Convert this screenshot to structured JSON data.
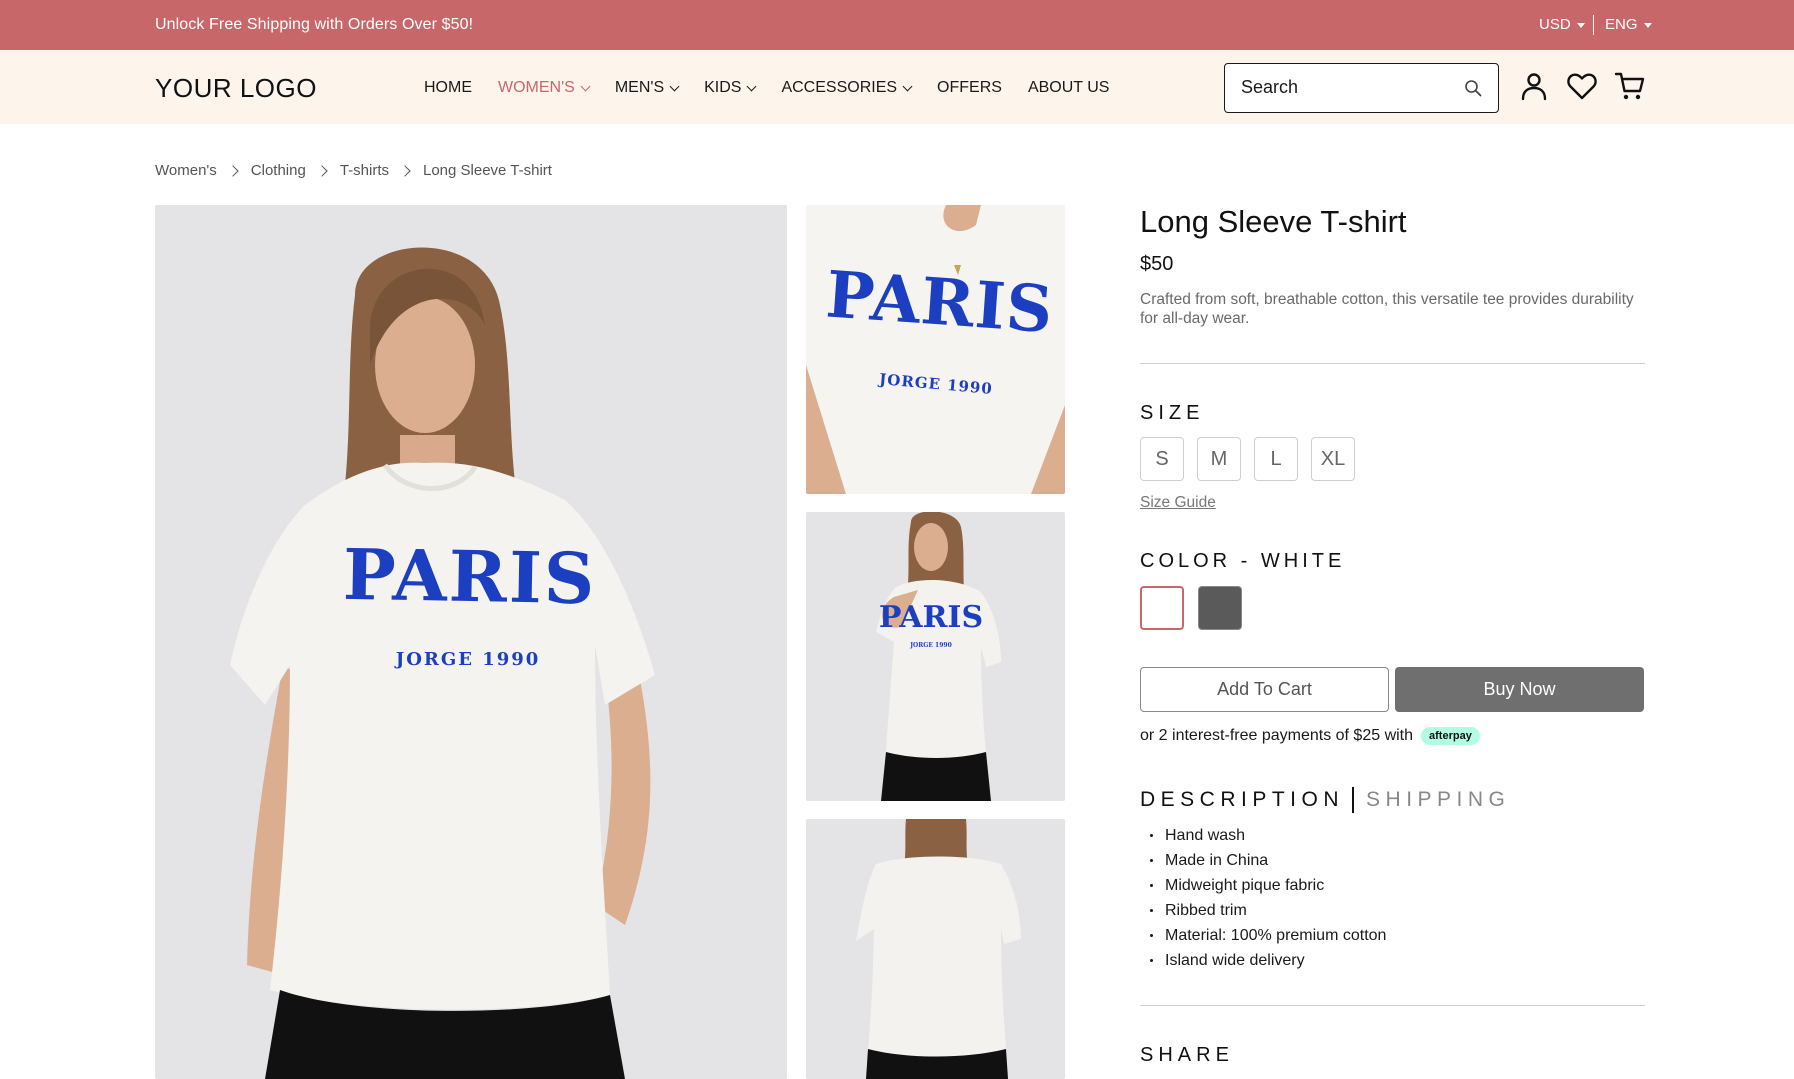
{
  "colors": {
    "brand": "#c8676a",
    "header_bg": "#fdf4ec",
    "buy_now": "#6f6f6f",
    "afterpay": "#b2fce4"
  },
  "promo": {
    "message": "Unlock Free Shipping with Orders Over $50!",
    "currency": "USD",
    "language": "ENG"
  },
  "header": {
    "logo": "YOUR LOGO",
    "nav": [
      {
        "label": "HOME",
        "dropdown": false,
        "active": false
      },
      {
        "label": "WOMEN'S",
        "dropdown": true,
        "active": true
      },
      {
        "label": "MEN'S",
        "dropdown": true,
        "active": false
      },
      {
        "label": "KIDS",
        "dropdown": true,
        "active": false
      },
      {
        "label": "ACCESSORIES",
        "dropdown": true,
        "active": false
      },
      {
        "label": "OFFERS",
        "dropdown": false,
        "active": false
      },
      {
        "label": "ABOUT US",
        "dropdown": false,
        "active": false
      }
    ],
    "search": {
      "placeholder": "Search",
      "icon": "search-icon"
    },
    "icons": [
      "account-icon",
      "wishlist-heart-icon",
      "cart-icon"
    ]
  },
  "breadcrumb": [
    "Women's",
    "Clothing",
    "T-shirts",
    "Long Sleeve T-shirt"
  ],
  "gallery": {
    "shirt_print_main": "PARIS",
    "shirt_print_sub": "JORGE 1990"
  },
  "product": {
    "title": "Long Sleeve T-shirt",
    "price": "$50",
    "description": "Crafted from soft, breathable cotton, this versatile tee provides durability for all-day wear.",
    "size_label": "SIZE",
    "sizes": [
      "S",
      "M",
      "L",
      "XL"
    ],
    "size_guide": "Size Guide",
    "color_label": "COLOR - WHITE",
    "color_options": [
      {
        "name": "white",
        "hex": "#ffffff",
        "selected": true
      },
      {
        "name": "charcoal",
        "hex": "#5a5a5a",
        "selected": false
      }
    ],
    "add_to_cart": "Add To Cart",
    "buy_now": "Buy Now",
    "afterpay_text": "or 2 interest-free payments of $25 with",
    "afterpay_badge": "afterpay",
    "tabs": [
      {
        "label": "DESCRIPTION",
        "active": true
      },
      {
        "label": "SHIPPING",
        "active": false
      }
    ],
    "details": [
      "Hand wash",
      "Made in China",
      "Midweight pique fabric",
      "Ribbed trim",
      "Material: 100% premium cotton",
      "Island wide delivery"
    ],
    "share_label": "SHARE"
  }
}
